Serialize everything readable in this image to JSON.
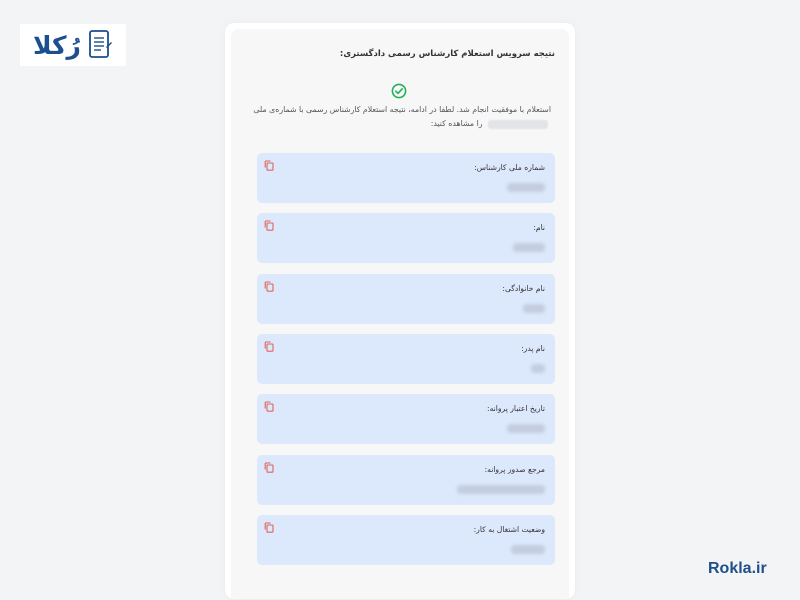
{
  "brand": {
    "logo_text": "رُکلا",
    "logo_icon": "document-icon",
    "site": "Rokla.ir"
  },
  "result": {
    "title": "نتیجه سرویس استعلام کارشناس رسمی دادگستری:",
    "status_icon": "check-circle-icon",
    "message_part1": "استعلام با موفقیت انجام شد. لطفا در ادامه، نتیجه استعلام کارشناس رسمی با شماره‌ی ملی",
    "message_part2": "را مشاهده کنید:"
  },
  "fields": [
    {
      "label": "شماره ملی کارشناس:",
      "value": "۰۰۰۰۰۰۰۰۰۰"
    },
    {
      "label": "نام:",
      "value": "*****"
    },
    {
      "label": "نام خانوادگی:",
      "value": "****"
    },
    {
      "label": "نام پدر:",
      "value": "***"
    },
    {
      "label": "تاریخ اعتبار پروانه:",
      "value": "۱۴۰۰/۰۰/۰۰"
    },
    {
      "label": "مرجع صدور پروانه:",
      "value": "******************"
    },
    {
      "label": "وضعیت اشتغال به کار:",
      "value": "*********"
    }
  ],
  "colors": {
    "accent": "#1d4f8f",
    "success": "#22b05a",
    "field_bg": "#dce8fc",
    "copy_icon": "#e0645a"
  }
}
